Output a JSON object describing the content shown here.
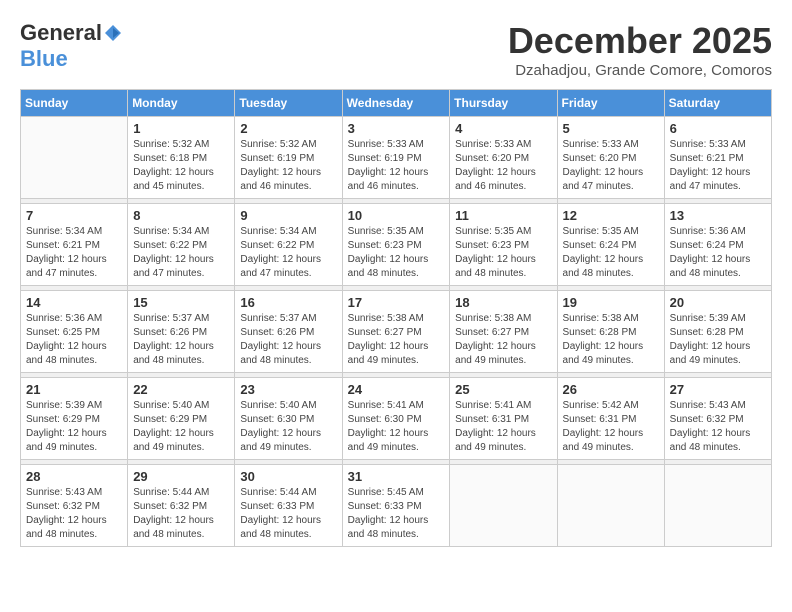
{
  "logo": {
    "general": "General",
    "blue": "Blue"
  },
  "title": "December 2025",
  "subtitle": "Dzahadjou, Grande Comore, Comoros",
  "days_of_week": [
    "Sunday",
    "Monday",
    "Tuesday",
    "Wednesday",
    "Thursday",
    "Friday",
    "Saturday"
  ],
  "weeks": [
    [
      {
        "date": "",
        "info": ""
      },
      {
        "date": "1",
        "info": "Sunrise: 5:32 AM\nSunset: 6:18 PM\nDaylight: 12 hours\nand 45 minutes."
      },
      {
        "date": "2",
        "info": "Sunrise: 5:32 AM\nSunset: 6:19 PM\nDaylight: 12 hours\nand 46 minutes."
      },
      {
        "date": "3",
        "info": "Sunrise: 5:33 AM\nSunset: 6:19 PM\nDaylight: 12 hours\nand 46 minutes."
      },
      {
        "date": "4",
        "info": "Sunrise: 5:33 AM\nSunset: 6:20 PM\nDaylight: 12 hours\nand 46 minutes."
      },
      {
        "date": "5",
        "info": "Sunrise: 5:33 AM\nSunset: 6:20 PM\nDaylight: 12 hours\nand 47 minutes."
      },
      {
        "date": "6",
        "info": "Sunrise: 5:33 AM\nSunset: 6:21 PM\nDaylight: 12 hours\nand 47 minutes."
      }
    ],
    [
      {
        "date": "7",
        "info": "Sunrise: 5:34 AM\nSunset: 6:21 PM\nDaylight: 12 hours\nand 47 minutes."
      },
      {
        "date": "8",
        "info": "Sunrise: 5:34 AM\nSunset: 6:22 PM\nDaylight: 12 hours\nand 47 minutes."
      },
      {
        "date": "9",
        "info": "Sunrise: 5:34 AM\nSunset: 6:22 PM\nDaylight: 12 hours\nand 47 minutes."
      },
      {
        "date": "10",
        "info": "Sunrise: 5:35 AM\nSunset: 6:23 PM\nDaylight: 12 hours\nand 48 minutes."
      },
      {
        "date": "11",
        "info": "Sunrise: 5:35 AM\nSunset: 6:23 PM\nDaylight: 12 hours\nand 48 minutes."
      },
      {
        "date": "12",
        "info": "Sunrise: 5:35 AM\nSunset: 6:24 PM\nDaylight: 12 hours\nand 48 minutes."
      },
      {
        "date": "13",
        "info": "Sunrise: 5:36 AM\nSunset: 6:24 PM\nDaylight: 12 hours\nand 48 minutes."
      }
    ],
    [
      {
        "date": "14",
        "info": "Sunrise: 5:36 AM\nSunset: 6:25 PM\nDaylight: 12 hours\nand 48 minutes."
      },
      {
        "date": "15",
        "info": "Sunrise: 5:37 AM\nSunset: 6:26 PM\nDaylight: 12 hours\nand 48 minutes."
      },
      {
        "date": "16",
        "info": "Sunrise: 5:37 AM\nSunset: 6:26 PM\nDaylight: 12 hours\nand 48 minutes."
      },
      {
        "date": "17",
        "info": "Sunrise: 5:38 AM\nSunset: 6:27 PM\nDaylight: 12 hours\nand 49 minutes."
      },
      {
        "date": "18",
        "info": "Sunrise: 5:38 AM\nSunset: 6:27 PM\nDaylight: 12 hours\nand 49 minutes."
      },
      {
        "date": "19",
        "info": "Sunrise: 5:38 AM\nSunset: 6:28 PM\nDaylight: 12 hours\nand 49 minutes."
      },
      {
        "date": "20",
        "info": "Sunrise: 5:39 AM\nSunset: 6:28 PM\nDaylight: 12 hours\nand 49 minutes."
      }
    ],
    [
      {
        "date": "21",
        "info": "Sunrise: 5:39 AM\nSunset: 6:29 PM\nDaylight: 12 hours\nand 49 minutes."
      },
      {
        "date": "22",
        "info": "Sunrise: 5:40 AM\nSunset: 6:29 PM\nDaylight: 12 hours\nand 49 minutes."
      },
      {
        "date": "23",
        "info": "Sunrise: 5:40 AM\nSunset: 6:30 PM\nDaylight: 12 hours\nand 49 minutes."
      },
      {
        "date": "24",
        "info": "Sunrise: 5:41 AM\nSunset: 6:30 PM\nDaylight: 12 hours\nand 49 minutes."
      },
      {
        "date": "25",
        "info": "Sunrise: 5:41 AM\nSunset: 6:31 PM\nDaylight: 12 hours\nand 49 minutes."
      },
      {
        "date": "26",
        "info": "Sunrise: 5:42 AM\nSunset: 6:31 PM\nDaylight: 12 hours\nand 49 minutes."
      },
      {
        "date": "27",
        "info": "Sunrise: 5:43 AM\nSunset: 6:32 PM\nDaylight: 12 hours\nand 48 minutes."
      }
    ],
    [
      {
        "date": "28",
        "info": "Sunrise: 5:43 AM\nSunset: 6:32 PM\nDaylight: 12 hours\nand 48 minutes."
      },
      {
        "date": "29",
        "info": "Sunrise: 5:44 AM\nSunset: 6:32 PM\nDaylight: 12 hours\nand 48 minutes."
      },
      {
        "date": "30",
        "info": "Sunrise: 5:44 AM\nSunset: 6:33 PM\nDaylight: 12 hours\nand 48 minutes."
      },
      {
        "date": "31",
        "info": "Sunrise: 5:45 AM\nSunset: 6:33 PM\nDaylight: 12 hours\nand 48 minutes."
      },
      {
        "date": "",
        "info": ""
      },
      {
        "date": "",
        "info": ""
      },
      {
        "date": "",
        "info": ""
      }
    ]
  ]
}
